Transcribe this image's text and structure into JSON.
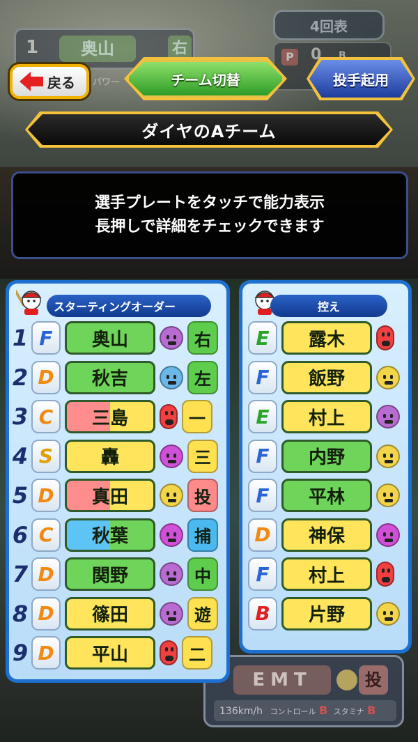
{
  "background": {
    "batter_plate": {
      "number": "1",
      "name": "奥山",
      "position": "右",
      "caption": "パワー"
    },
    "inning": "4回表",
    "count": {
      "p_label": "P",
      "p_value": "0",
      "b_label": "B"
    },
    "pitcher_card": {
      "name": "EMT",
      "position": "投",
      "speed": "136km/h",
      "control_label": "コントロール",
      "control_grade": "B",
      "stamina_label": "スタミナ",
      "stamina_grade": "B"
    }
  },
  "header": {
    "back_label": "戻る",
    "team_switch_label": "チーム切替",
    "pitcher_button_label": "投手起用",
    "team_name": "ダイヤのAチーム"
  },
  "info": {
    "line1": "選手プレートをタッチで能力表示",
    "line2": "長押しで詳細をチェックできます"
  },
  "starting_order": {
    "title": "スターティングオーダー",
    "rows": [
      {
        "order": "1",
        "grade": "F",
        "name": "奥山",
        "face": "sad",
        "position": "右"
      },
      {
        "order": "2",
        "grade": "D",
        "name": "秋吉",
        "face": "worried",
        "position": "左"
      },
      {
        "order": "3",
        "grade": "C",
        "name": "三島",
        "face": "red",
        "position": "一"
      },
      {
        "order": "4",
        "grade": "S",
        "name": "轟",
        "face": "happy",
        "position": "三"
      },
      {
        "order": "5",
        "grade": "D",
        "name": "真田",
        "face": "neutral",
        "position": "投"
      },
      {
        "order": "6",
        "grade": "C",
        "name": "秋葉",
        "face": "happy",
        "position": "捕"
      },
      {
        "order": "7",
        "grade": "D",
        "name": "関野",
        "face": "sad",
        "position": "中"
      },
      {
        "order": "8",
        "grade": "D",
        "name": "篠田",
        "face": "sad",
        "position": "遊"
      },
      {
        "order": "9",
        "grade": "D",
        "name": "平山",
        "face": "red",
        "position": "二"
      }
    ]
  },
  "bench": {
    "title": "控え",
    "rows": [
      {
        "grade": "E",
        "name": "露木",
        "face": "red"
      },
      {
        "grade": "F",
        "name": "飯野",
        "face": "neutral"
      },
      {
        "grade": "E",
        "name": "村上",
        "face": "sad"
      },
      {
        "grade": "F",
        "name": "内野",
        "face": "neutral"
      },
      {
        "grade": "F",
        "name": "平林",
        "face": "neutral"
      },
      {
        "grade": "D",
        "name": "神保",
        "face": "happy"
      },
      {
        "grade": "F",
        "name": "村上",
        "face": "red"
      },
      {
        "grade": "B",
        "name": "片野",
        "face": "neutral"
      }
    ]
  },
  "colors": {
    "grade_F": "#2a64d8",
    "grade_D": "#f08a10",
    "grade_C": "#f08a10",
    "grade_S": "#e0a000",
    "grade_E": "#2aa52a",
    "grade_B": "#e02020",
    "plate_green": "#6ed55a",
    "plate_yellow": "#ffe45c",
    "plate_red": "#ff8d8d",
    "plate_blue": "#5ec3f5",
    "face_sad": "#b86bd0",
    "face_worried": "#6ab8e8",
    "face_red": "#f04040",
    "face_happy": "#d050d8",
    "face_neutral": "#f3d54a",
    "pos_green": "#5ecc4c",
    "pos_yellow": "#ffe050",
    "pos_red": "#ff8a8a",
    "pos_blue": "#4cb8f0"
  }
}
